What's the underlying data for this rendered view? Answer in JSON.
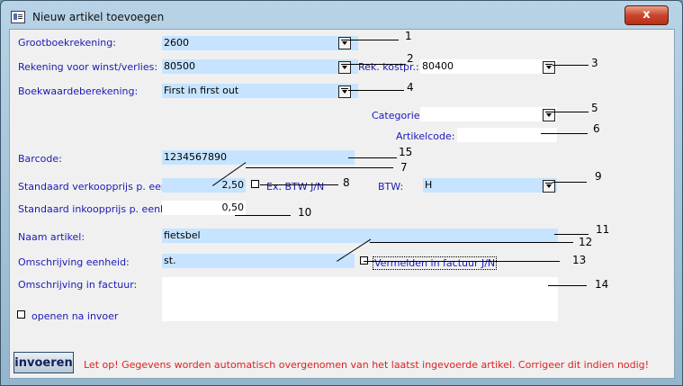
{
  "window": {
    "title": "Nieuw artikel toevoegen",
    "close_label": "x"
  },
  "fields": {
    "grootboek": {
      "label": "Grootboekrekening:",
      "value": "2600"
    },
    "winstverlies": {
      "label": "Rekening voor winst/verlies:",
      "value": "80500"
    },
    "kostpr": {
      "label": "Rek. kostpr.:",
      "value": "80400"
    },
    "boekwaarde": {
      "label": "Boekwaardeberekening:",
      "value": "First in first out"
    },
    "categorie": {
      "label": "Categorie:",
      "value": ""
    },
    "artikelcode": {
      "label": "Artikelcode:",
      "value": ""
    },
    "barcode": {
      "label": "Barcode:",
      "value": "1234567890"
    },
    "verkoopprijs": {
      "label": "Standaard verkoopprijs p. eenh:",
      "value": "2,50"
    },
    "ex_btw": {
      "label": "Ex. BTW J/N"
    },
    "btw": {
      "label": "BTW:",
      "value": "H"
    },
    "inkoopprijs": {
      "label": "Standaard inkoopprijs p. eenh:",
      "value": "0,50"
    },
    "naam": {
      "label": "Naam artikel:",
      "value": "fietsbel"
    },
    "eenheid": {
      "label": "Omschrijving eenheid:",
      "value": "st."
    },
    "vermelden": {
      "label": "Vermelden in factuur J/N"
    },
    "factuur": {
      "label": "Omschrijving in factuur:",
      "value": ""
    },
    "openen": {
      "label": "openen na invoer"
    }
  },
  "callouts": [
    "1",
    "2",
    "3",
    "4",
    "5",
    "6",
    "7",
    "8",
    "9",
    "10",
    "11",
    "12",
    "13",
    "14",
    "15"
  ],
  "footer": {
    "submit_label": "invoeren",
    "warning": "Let op! Gegevens worden automatisch overgenomen van het laatst ingevoerde artikel. Corrigeer dit indien nodig!"
  },
  "colors": {
    "field_bg": "#c6e4ff",
    "label_color": "#1a1ab8",
    "warning_color": "#e02020"
  }
}
